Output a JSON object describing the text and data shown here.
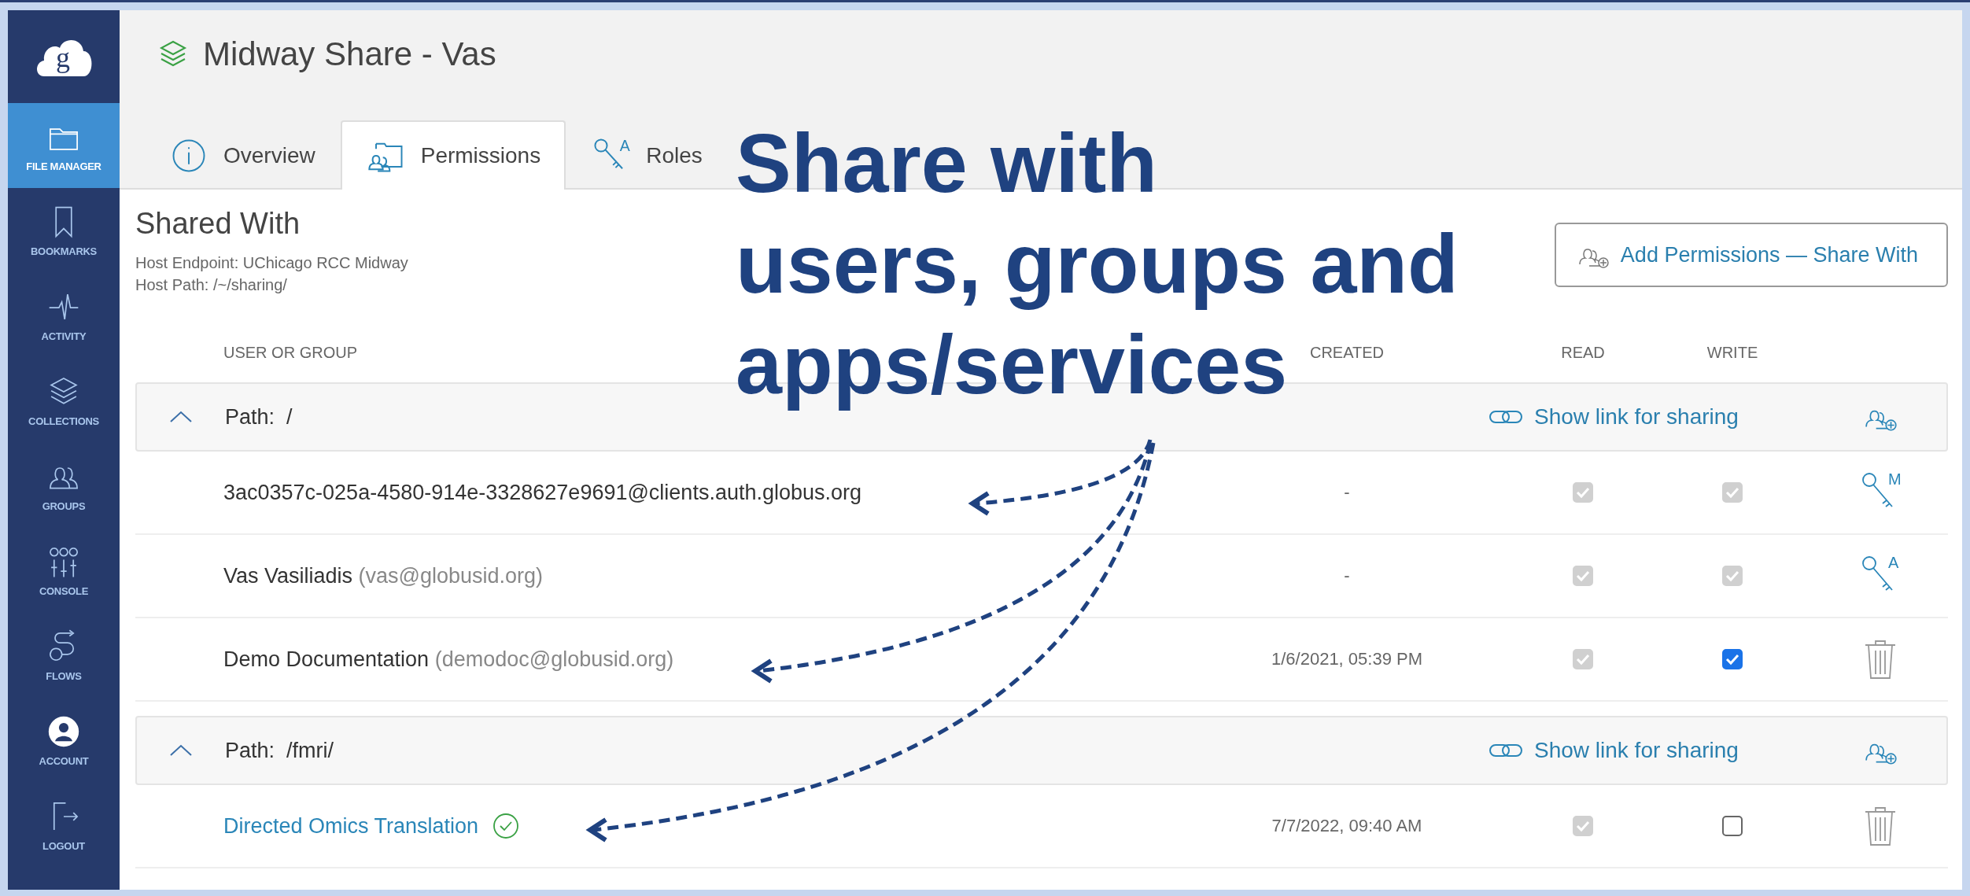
{
  "sidebar": {
    "logo_letter": "g",
    "items": [
      {
        "label": "FILE MANAGER",
        "selected": true
      },
      {
        "label": "BOOKMARKS",
        "selected": false
      },
      {
        "label": "ACTIVITY",
        "selected": false
      },
      {
        "label": "COLLECTIONS",
        "selected": false
      },
      {
        "label": "GROUPS",
        "selected": false
      },
      {
        "label": "CONSOLE",
        "selected": false
      },
      {
        "label": "FLOWS",
        "selected": false
      },
      {
        "label": "ACCOUNT",
        "selected": false
      },
      {
        "label": "LOGOUT",
        "selected": false
      }
    ]
  },
  "header": {
    "title": "Midway Share - Vas"
  },
  "tabs": [
    {
      "label": "Overview",
      "selected": false
    },
    {
      "label": "Permissions",
      "selected": true
    },
    {
      "label": "Roles",
      "selected": false,
      "icon_letter": "A"
    }
  ],
  "shared_with": {
    "title": "Shared With",
    "host_endpoint": "Host Endpoint: UChicago RCC Midway",
    "host_path": "Host Path: /~/sharing/",
    "button": "Add Permissions — Share With"
  },
  "table": {
    "columns": [
      "USER OR GROUP",
      "CREATED",
      "READ",
      "WRITE"
    ],
    "paths": [
      {
        "label": "Path:  /",
        "expanded": true,
        "link": "Show link for sharing",
        "rows": [
          {
            "kind": "identity",
            "name": "3ac0357c-025a-4580-914e-3328627e9691@clients.auth.globus.org",
            "created": "-",
            "read": {
              "checked": true,
              "disabled": true
            },
            "write": {
              "checked": true,
              "disabled": true
            },
            "action": {
              "kind": "role",
              "letter": "M"
            }
          },
          {
            "kind": "identity",
            "name": "Vas Vasiliadis",
            "detail": "(vas@globusid.org)",
            "created": "-",
            "read": {
              "checked": true,
              "disabled": true
            },
            "write": {
              "checked": true,
              "disabled": true
            },
            "action": {
              "kind": "role",
              "letter": "A"
            }
          },
          {
            "kind": "identity",
            "name": "Demo Documentation",
            "detail": "(demodoc@globusid.org)",
            "created": "1/6/2021, 05:39 PM",
            "read": {
              "checked": true,
              "disabled": true
            },
            "write": {
              "checked": true,
              "disabled": false
            },
            "action": {
              "kind": "delete"
            }
          }
        ]
      },
      {
        "label": "Path:  /fmri/",
        "expanded": true,
        "link": "Show link for sharing",
        "rows": [
          {
            "kind": "app",
            "name": "Directed Omics Translation",
            "created": "7/7/2022, 09:40 AM",
            "read": {
              "checked": true,
              "disabled": true
            },
            "write": {
              "checked": false,
              "disabled": false
            },
            "action": {
              "kind": "delete"
            }
          }
        ]
      }
    ]
  },
  "annotation": {
    "lines": [
      "Share with",
      "users, groups and",
      "apps/services"
    ]
  }
}
